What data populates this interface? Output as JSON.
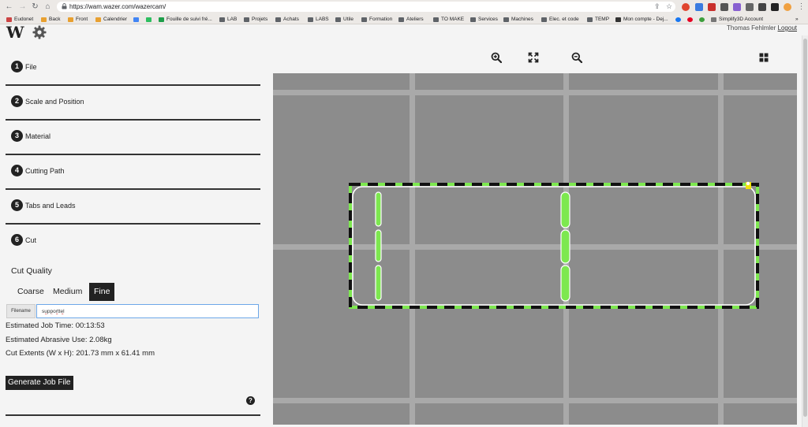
{
  "browser": {
    "url": "https://wam.wazer.com/wazercam/",
    "bookmarks": [
      "Eudonet",
      "Back",
      "Front",
      "Calendrier",
      "Fouille de suivi fré...",
      "LAB",
      "Projets",
      "Achats",
      "LABS",
      "Utile",
      "Formation",
      "Ateliers",
      "TO MAKE",
      "Services",
      "Machines",
      "Elec. et code",
      "TEMP",
      "Mon compte - Dej...",
      "Simplify3D Account"
    ],
    "more_bookmarks": "»"
  },
  "app": {
    "logo": "W",
    "user_name": "Thomas Fehlmler",
    "logout_label": "Logout"
  },
  "steps": [
    {
      "number": "1",
      "label": "File"
    },
    {
      "number": "2",
      "label": "Scale and Position"
    },
    {
      "number": "3",
      "label": "Material"
    },
    {
      "number": "4",
      "label": "Cutting Path"
    },
    {
      "number": "5",
      "label": "Tabs and Leads"
    },
    {
      "number": "6",
      "label": "Cut"
    }
  ],
  "cut": {
    "quality_label": "Cut Quality",
    "quality_options": [
      "Coarse",
      "Medium",
      "Fine"
    ],
    "selected_quality": "Fine",
    "filename_label": "Filename",
    "filename_value": "supporttel",
    "job_time": "Estimated Job Time: 00:13:53",
    "abrasive_use": "Estimated Abrasive Use: 2.08kg",
    "cut_extents": "Cut Extents (W x H): 201.73 mm x 61.41 mm",
    "generate_label": "Generate Job File",
    "help_label": "?"
  },
  "colors": {
    "accent_green": "#7de84f",
    "cut_outline": "#ffffff",
    "workspace": "#8c8c8c",
    "grid": "#a9a9a9",
    "handle": "#f2e30c"
  },
  "toolbar": {
    "icons": [
      "zoom-in-icon",
      "fit-screen-icon",
      "zoom-out-icon",
      "grid-view-icon"
    ]
  }
}
